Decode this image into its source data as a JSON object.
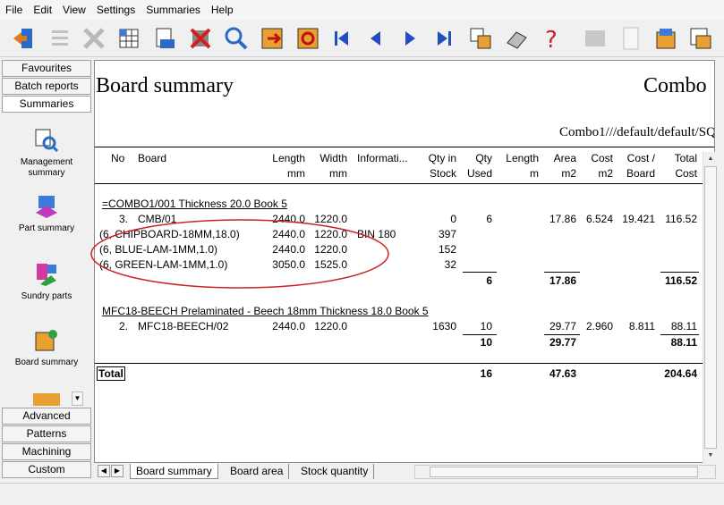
{
  "menu": [
    "File",
    "Edit",
    "View",
    "Settings",
    "Summaries",
    "Help"
  ],
  "toolbar": {
    "icons": [
      "exit-icon",
      "list-icon",
      "tools-icon",
      "grid-icon",
      "print-icon",
      "delete-icon",
      "search-icon",
      "export-icon",
      "import-icon",
      "first-page-icon",
      "previous-page-icon",
      "next-page-icon",
      "last-page-icon",
      "layout-icon",
      "eraser-icon",
      "help-icon",
      "settings-icon",
      "document-icon",
      "report-icon",
      "batch-icon"
    ]
  },
  "sidebar": {
    "top_tabs": [
      "Favourites",
      "Batch reports",
      "Summaries"
    ],
    "entries": [
      "Management summary",
      "Part summary",
      "Sundry parts",
      "Board summary"
    ],
    "bottom_tabs": [
      "Advanced",
      "Patterns",
      "Machining",
      "Custom"
    ]
  },
  "report": {
    "title": "Board summary",
    "title_right": "Combo",
    "path": "Combo1///default/default/SQ",
    "headers": {
      "no": "No",
      "board": "Board",
      "length1": "Length",
      "length2": "mm",
      "width1": "Width",
      "width2": "mm",
      "info": "Informati...",
      "qtystock1": "Qty in",
      "qtystock2": "Stock",
      "qtyused1": "Qty",
      "qtyused2": "Used",
      "lengthm1": "Length",
      "lengthm2": "m",
      "area1": "Area",
      "area2": "m2",
      "cost1": "Cost",
      "cost2": "m2",
      "costb1": "Cost /",
      "costb2": "Board",
      "total1": "Total",
      "total2": "Cost"
    },
    "group1": {
      "header": "=COMBO1/001  Thickness  20.0 Book 5",
      "main": {
        "no": "3.",
        "board": "CMB/01",
        "length": "2440.0",
        "width": "1220.0",
        "stock": "0",
        "used": "6",
        "area": "17.86",
        "cost": "6.524",
        "costb": "19.421",
        "total": "116.52"
      },
      "subs": [
        {
          "board": "(6, CHIPBOARD-18MM,18.0)",
          "length": "2440.0",
          "width": "1220.0",
          "info": "BIN 180",
          "stock": "397"
        },
        {
          "board": "(6, BLUE-LAM-1MM,1.0)",
          "length": "2440.0",
          "width": "1220.0",
          "stock": "152"
        },
        {
          "board": "(6, GREEN-LAM-1MM,1.0)",
          "length": "3050.0",
          "width": "1525.0",
          "stock": "32"
        }
      ],
      "sub_used": "6",
      "sub_area": "17.86",
      "sub_total": "116.52"
    },
    "group2": {
      "header": "MFC18-BEECH Prelaminated - Beech 18mm Thickness  18.0 Book 5",
      "main": {
        "no": "2.",
        "board": "MFC18-BEECH/02",
        "length": "2440.0",
        "width": "1220.0",
        "stock": "1630",
        "used": "10",
        "area": "29.77",
        "cost": "2.960",
        "costb": "8.811",
        "total": "88.11"
      },
      "sub_used": "10",
      "sub_area": "29.77",
      "sub_total": "88.11"
    },
    "total": {
      "label": "Total",
      "used": "16",
      "area": "47.63",
      "cost": "204.64"
    }
  },
  "bottom_tabs": [
    "Board summary",
    "Board area",
    "Stock quantity"
  ],
  "colors": {
    "annotation": "#cc2222"
  }
}
